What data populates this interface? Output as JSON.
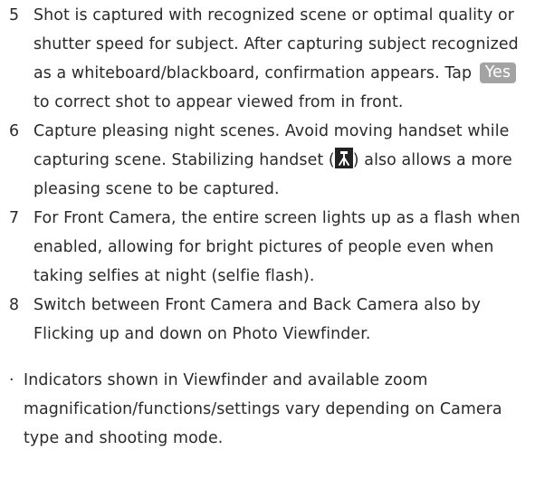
{
  "items": [
    {
      "number": "5",
      "text_before": "Shot is captured with recognized scene or optimal quality or shutter speed for subject. After capturing subject recognized as a whiteboard/blackboard, confirmation appears. Tap",
      "pill": "Yes",
      "text_after": "to correct shot to appear viewed from in front."
    },
    {
      "number": "6",
      "text_before": "Capture pleasing night scenes. Avoid moving handset while capturing scene. Stabilizing handset (",
      "icon": "tripod-icon",
      "text_after": ") also allows a more pleasing scene to be captured."
    },
    {
      "number": "7",
      "text": "For Front Camera, the entire screen lights up as a flash when enabled, allowing for bright pictures of people even when taking selfies at night (selfie flash)."
    },
    {
      "number": "8",
      "text": "Switch between Front Camera and Back Camera also by Flicking up and down on Photo Viewfinder."
    }
  ],
  "note": {
    "bullet": "·",
    "text": "Indicators shown in Viewfinder and available zoom magnification/functions/settings vary depending on Camera type and shooting mode."
  },
  "colors": {
    "text": "#2a2a2a",
    "pill_background": "#a3a3a3",
    "pill_text": "#ffffff",
    "icon_background": "#222222"
  }
}
